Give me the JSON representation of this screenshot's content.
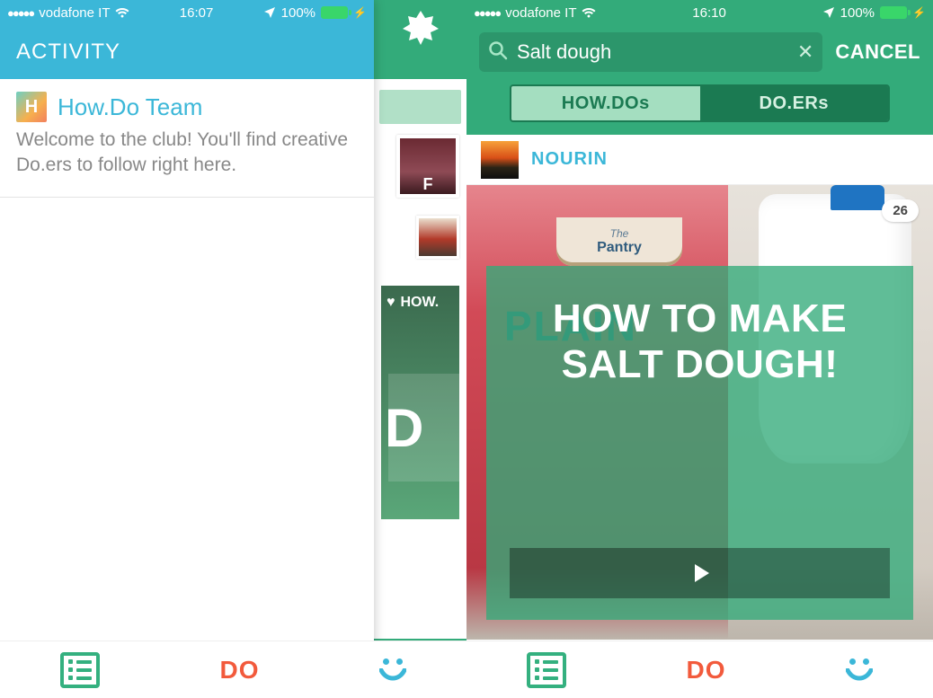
{
  "left": {
    "status": {
      "carrier": "vodafone IT",
      "time": "16:07",
      "battery": "100%"
    },
    "header": {
      "title": "ACTIVITY"
    },
    "peek": {
      "avatar_letter": "F",
      "heart_label": "HOW.",
      "big_letter": "D"
    },
    "activity": {
      "avatar_letter": "H",
      "title": "How.Do Team",
      "body": "Welcome to the club! You'll find creative Do.ers to follow right here."
    },
    "tabs": {
      "do": "DO"
    }
  },
  "right": {
    "status": {
      "carrier": "vodafone IT",
      "time": "16:10",
      "battery": "100%"
    },
    "search": {
      "value": "Salt dough",
      "cancel": "CANCEL"
    },
    "segments": {
      "howdos": "HOW.DOs",
      "doers": "DO.ERs"
    },
    "user": {
      "name": "NOURIN"
    },
    "card": {
      "views": "26",
      "bag_brand_small": "The",
      "bag_brand": "Pantry",
      "bag_word": "PLAIN",
      "title": "HOW TO MAKE SALT DOUGH!"
    },
    "tabs": {
      "do": "DO"
    }
  }
}
